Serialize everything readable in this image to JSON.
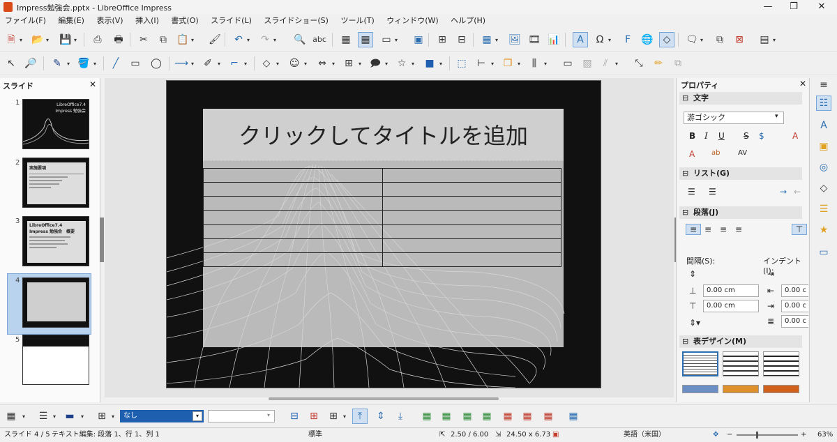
{
  "window": {
    "title": "Impress勉強会.pptx - LibreOffice Impress",
    "minimize": "—",
    "maximize": "❐",
    "close": "✕"
  },
  "menu": [
    "ファイル(F)",
    "編集(E)",
    "表示(V)",
    "挿入(I)",
    "書式(O)",
    "スライド(L)",
    "スライドショー(S)",
    "ツール(T)",
    "ウィンドウ(W)",
    "ヘルプ(H)"
  ],
  "slidepane": {
    "title": "スライド",
    "close": "✕",
    "numbers": [
      "1",
      "2",
      "3",
      "4",
      "5"
    ],
    "thumb1": {
      "line1": "LibreOffice7.4",
      "line2": "Impress 勉強会"
    },
    "thumb2": {
      "title": "実施要項"
    },
    "thumb3": {
      "title": "LibreOffice7.4",
      "subtitle": "Impress 勉強会　概要"
    }
  },
  "slide": {
    "title": "クリックしてタイトルを追加"
  },
  "sidebar": {
    "title": "プロパティ",
    "close": "✕",
    "menu": "≡",
    "char_section": "文字",
    "font_name": "游ゴシック",
    "list_section": "リスト(G)",
    "para_section": "段落(J)",
    "spacing_label": "間隔(S):",
    "indent_label": "インデント(I):",
    "spacing_above": "0.00 cm",
    "spacing_below": "0.00 cm",
    "indent1": "0.00 c",
    "indent2": "0.00 c",
    "indent3": "0.00 c",
    "table_section": "表デザイン(M)"
  },
  "bottom": {
    "border_style": "なし",
    "border_style2": ""
  },
  "status": {
    "slide": "スライド 4 / 5",
    "edit": "テキスト編集: 段落 1、行 1、列 1",
    "layout": "標準",
    "position": "2.50 / 6.00",
    "size": "24.50 x 6.73",
    "language": "英語（米国）",
    "zoom": "63%"
  },
  "colors": {
    "accent": "#2a6db0",
    "slide_bg": "#111111",
    "title_fill": "#cfcfcf"
  },
  "icons": [
    "save-icon",
    "undo-icon",
    "redo-icon",
    "table-icon",
    "image-icon",
    "chart-icon",
    "special-char-icon",
    "fontwork-icon",
    "select-icon",
    "zoom-icon",
    "line-icon",
    "rectangle-icon",
    "ellipse-icon",
    "arrow-icon",
    "curve-icon",
    "connector-icon",
    "diamond-icon",
    "smiley-icon",
    "double-arrow-icon",
    "flowchart-icon",
    "callout-icon",
    "star-icon",
    "3d-object-icon"
  ]
}
